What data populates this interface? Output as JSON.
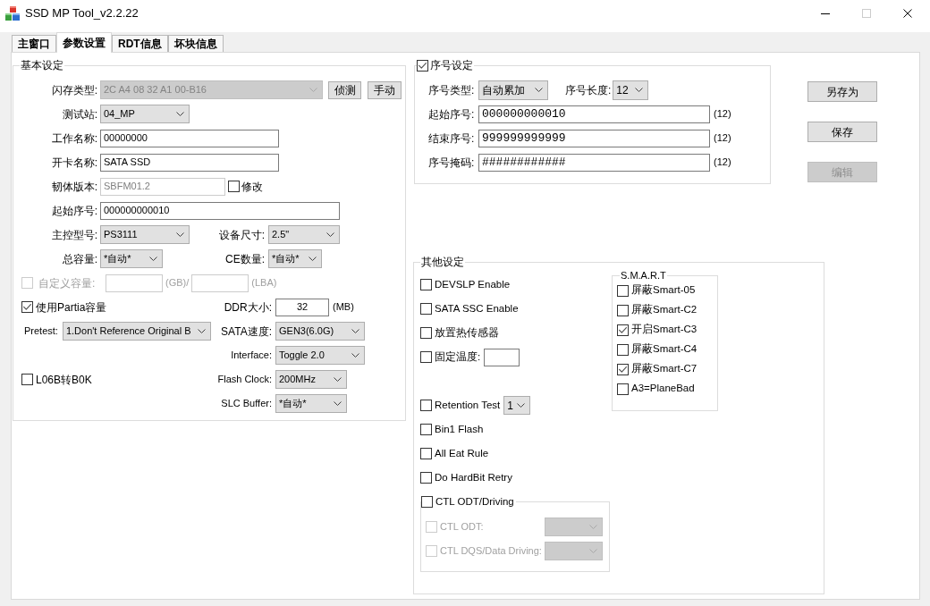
{
  "window": {
    "title": "SSD MP Tool_v2.2.22",
    "controls": [
      {
        "kind": "minimize",
        "disabled": false
      },
      {
        "kind": "maximize",
        "disabled": true
      },
      {
        "kind": "close",
        "disabled": false
      }
    ]
  },
  "tabs": [
    {
      "label": "主窗口",
      "selected": false
    },
    {
      "label": "参数设置",
      "selected": true
    },
    {
      "label": "RDT信息",
      "selected": false
    },
    {
      "label": "坏块信息",
      "selected": false
    }
  ],
  "basic_settings": {
    "title": "基本设定",
    "flash_type": {
      "label": "闪存类型:",
      "value": "2C A4 08 32 A1 00-B16",
      "disabled": true
    },
    "buttons": [
      "侦测",
      "手动"
    ],
    "test_station": {
      "label": "测试站:",
      "value": "04_MP"
    },
    "job_name": {
      "label": "工作名称:",
      "value": "00000000"
    },
    "card_name": {
      "label": "开卡名称:",
      "value": "SATA SSD"
    },
    "firmware_version": {
      "label": "韧体版本:",
      "value": "SBFM01.2",
      "disabled": true
    },
    "modify": {
      "label": "修改",
      "checked": false
    },
    "start_serial": {
      "label": "起始序号:",
      "value": "000000000010"
    },
    "controller": {
      "label": "主控型号:",
      "value": "PS3111"
    },
    "form_factor": {
      "label": "设备尺寸:",
      "value": "2.5\""
    },
    "capacity": {
      "label": "总容量:",
      "value": "*自动*"
    },
    "ce_count": {
      "label": "CE数量:",
      "value": "*自动*"
    },
    "custom_capacity": {
      "label": "自定义容量:",
      "checked": false,
      "disabled": true,
      "gb_unit": "(GB)/",
      "lba_unit": "(LBA)"
    },
    "use_partial": {
      "label": "使用Partia容量",
      "checked": true
    },
    "ddr_size": {
      "label": "DDR大小:",
      "value": "32",
      "unit": "(MB)"
    },
    "pretest": {
      "label": "Pretest:",
      "value": "1.Don't Reference Original B"
    },
    "sata_speed": {
      "label": "SATA速度:",
      "value": "GEN3(6.0G)"
    },
    "interface": {
      "label": "Interface:",
      "value": "Toggle 2.0"
    },
    "l06b": {
      "label": "L06B转B0K",
      "checked": false
    },
    "flash_clock": {
      "label": "Flash Clock:",
      "value": "200MHz"
    },
    "slc_buffer": {
      "label": "SLC Buffer:",
      "value": "*自动*"
    }
  },
  "serial_settings": {
    "title": "序号设定",
    "checked": true,
    "type": {
      "label": "序号类型:",
      "value": "自动累加"
    },
    "length": {
      "label": "序号长度:",
      "value": "12"
    },
    "fields": [
      {
        "label": "起始序号:",
        "value": "000000000010",
        "count": "(12)"
      },
      {
        "label": "结束序号:",
        "value": "999999999999",
        "count": "(12)"
      },
      {
        "label": "序号掩码:",
        "value": "############",
        "count": "(12)"
      }
    ]
  },
  "action_buttons": [
    {
      "label": "另存为",
      "disabled": false
    },
    {
      "label": "保存",
      "disabled": false
    },
    {
      "label": "编辑",
      "disabled": true
    }
  ],
  "other_settings": {
    "title": "其他设定",
    "options": [
      {
        "kind": "checkbox",
        "label": "DEVSLP Enable",
        "checked": false
      },
      {
        "kind": "checkbox",
        "label": "SATA SSC Enable",
        "checked": false
      },
      {
        "kind": "checkbox",
        "label": "放置热传感器",
        "checked": false
      },
      {
        "kind": "checkbox_input",
        "label": "固定温度:",
        "checked": false
      },
      {
        "kind": "checkbox_select",
        "label": "Retention Test",
        "checked": false,
        "value": "1"
      },
      {
        "kind": "checkbox",
        "label": "Bin1 Flash",
        "checked": false
      },
      {
        "kind": "checkbox",
        "label": "All Eat Rule",
        "checked": false
      },
      {
        "kind": "checkbox",
        "label": "Do HardBit Retry",
        "checked": false
      }
    ],
    "ctl_group": {
      "label": "CTL ODT/Driving",
      "checked": false,
      "items": [
        {
          "label": "CTL ODT:",
          "checked": false,
          "disabled": true
        },
        {
          "label": "CTL DQS/Data Driving:",
          "checked": false,
          "disabled": true
        }
      ]
    },
    "smart": {
      "title": "S.M.A.R.T",
      "items": [
        {
          "label": "屏蔽Smart-05",
          "checked": false
        },
        {
          "label": "屏蔽Smart-C2",
          "checked": false
        },
        {
          "label": "开启Smart-C3",
          "checked": true
        },
        {
          "label": "屏蔽Smart-C4",
          "checked": false
        },
        {
          "label": "屏蔽Smart-C7",
          "checked": true
        },
        {
          "label": "A3=PlaneBad",
          "checked": false
        }
      ]
    }
  }
}
